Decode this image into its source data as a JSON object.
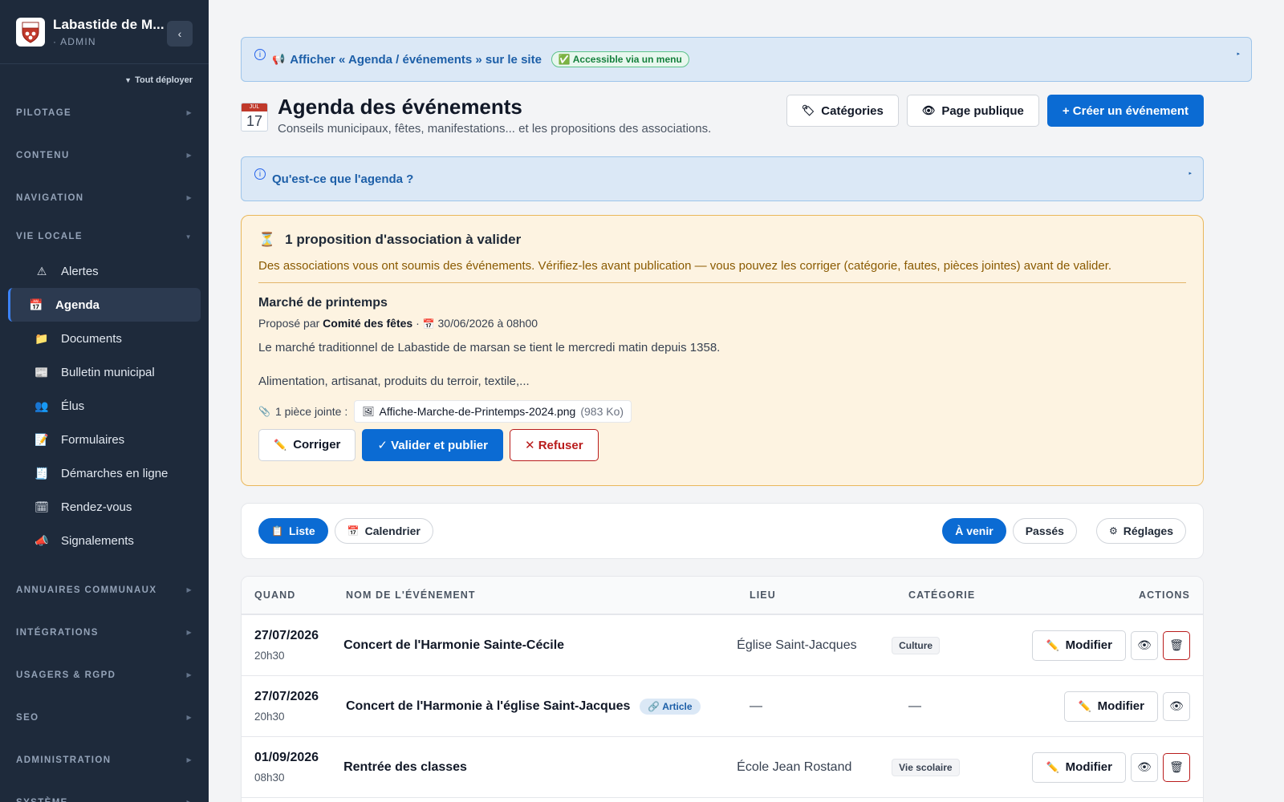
{
  "sidebar": {
    "brand_name": "Labastide de M...",
    "brand_role": "· ADMIN",
    "collapse_glyph": "‹",
    "expand_all": "Tout déployer",
    "sections_before": [
      {
        "label": "PILOTAGE"
      },
      {
        "label": "CONTENU"
      },
      {
        "label": "NAVIGATION"
      }
    ],
    "open_section": "VIE LOCALE",
    "items": [
      {
        "label": "Alertes",
        "icon": "⚠"
      },
      {
        "label": "Agenda",
        "icon": "📅"
      },
      {
        "label": "Documents",
        "icon": "📁"
      },
      {
        "label": "Bulletin municipal",
        "icon": "📰"
      },
      {
        "label": "Élus",
        "icon": "👥"
      },
      {
        "label": "Formulaires",
        "icon": "📝"
      },
      {
        "label": "Démarches en ligne",
        "icon": "🧾"
      },
      {
        "label": "Rendez-vous",
        "icon": "🗓"
      },
      {
        "label": "Signalements",
        "icon": "📣"
      }
    ],
    "sections_after": [
      {
        "label": "ANNUAIRES COMMUNAUX"
      },
      {
        "label": "INTÉGRATIONS"
      },
      {
        "label": "USAGERS & RGPD"
      },
      {
        "label": "SEO"
      },
      {
        "label": "ADMINISTRATION"
      },
      {
        "label": "SYSTÈME"
      }
    ]
  },
  "info_bar": {
    "link": "Afficher « Agenda / événements » sur le site",
    "badge": "✅ Accessible via un menu"
  },
  "header": {
    "cal_month": "JUL",
    "cal_day": "17",
    "title": "Agenda des événements",
    "subtitle": "Conseils municipaux, fêtes, manifestations... et les propositions des associations.",
    "btn_categories": "Catégories",
    "btn_public": "Page publique",
    "btn_create": "+ Créer un événement"
  },
  "faq": {
    "link": "Qu'est-ce que l'agenda ?"
  },
  "pending": {
    "title": "1 proposition d'association à valider",
    "description": "Des associations vous ont soumis des événements. Vérifiez-les avant publication — vous pouvez les corriger (catégorie, fautes, pièces jointes) avant de valider.",
    "event_title": "Marché de printemps",
    "proposed_by_prefix": "Proposé par",
    "proposer": "Comité des fêtes",
    "datetime": "30/06/2026 à 08h00",
    "body_p1": "Le marché traditionnel de Labastide de marsan se tient le mercredi matin depuis 1358.",
    "body_p2": "Alimentation, artisanat, produits du terroir, textile,...",
    "attach_label": "1 pièce jointe :",
    "file_name": "Affiche-Marche-de-Printemps-2024.png",
    "file_size": "(983 Ko)",
    "btn_fix": "Corriger",
    "btn_validate": "✓ Valider et publier",
    "btn_refuse": "✕ Refuser"
  },
  "filters": {
    "list": "Liste",
    "calendar": "Calendrier",
    "upcoming": "À venir",
    "past": "Passés",
    "settings": "Réglages"
  },
  "table": {
    "headers": {
      "when": "QUAND",
      "name": "NOM DE L'ÉVÉNEMENT",
      "place": "LIEU",
      "category": "CATÉGORIE",
      "actions": "ACTIONS"
    },
    "edit_label": "Modifier",
    "rows": [
      {
        "date": "27/07/2026",
        "time": "20h30",
        "name": "Concert de l'Harmonie Sainte-Cécile",
        "badge": "",
        "place": "Église Saint-Jacques",
        "category": "Culture",
        "deletable": true
      },
      {
        "date": "27/07/2026",
        "time": "20h30",
        "name": "Concert de l'Harmonie à l'église Saint-Jacques",
        "badge": "🔗 Article",
        "place": "—",
        "category": "—",
        "deletable": false
      },
      {
        "date": "01/09/2026",
        "time": "08h30",
        "name": "Rentrée des classes",
        "badge": "",
        "place": "École Jean Rostand",
        "category": "Vie scolaire",
        "deletable": true
      }
    ]
  }
}
